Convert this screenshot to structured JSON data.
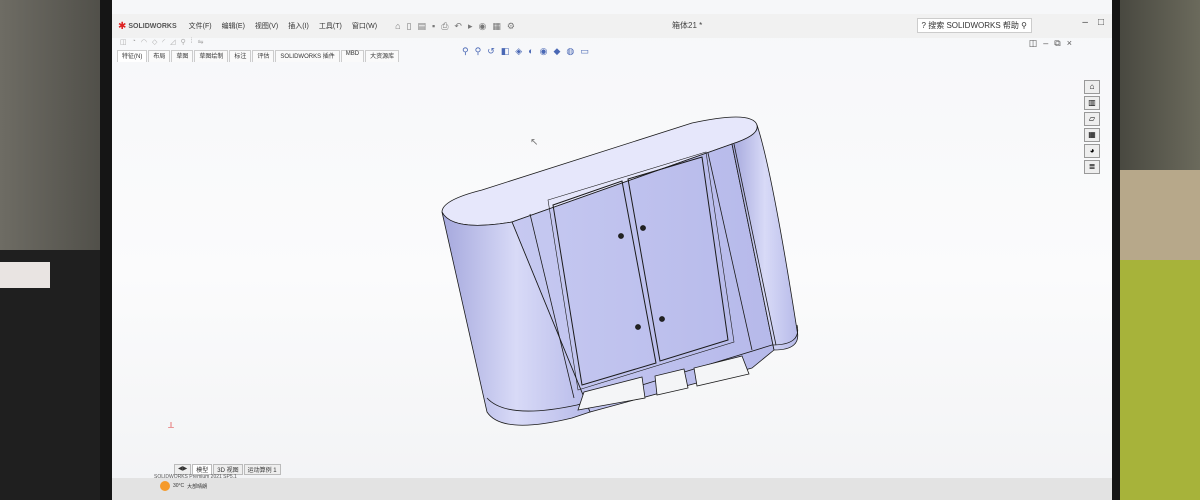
{
  "app": {
    "name": "SOLIDWORKS",
    "document_title": "箱体21 *"
  },
  "menu": [
    "文件(F)",
    "编辑(E)",
    "视图(V)",
    "插入(I)",
    "工具(T)",
    "窗口(W)"
  ],
  "search": {
    "label": "搜索 SOLIDWORKS 帮助"
  },
  "command_tabs": [
    "特征(N)",
    "布局",
    "草图",
    "草图绘制",
    "标注",
    "评估",
    "SOLIDWORKS 插件",
    "MBD",
    "大资源库"
  ],
  "bottom_tabs": [
    "模型",
    "3D 视图",
    "运动算例 1"
  ],
  "status_text": "SOLIDWORKS Premium 2021 SP5.1",
  "weather": {
    "temp": "30°C",
    "desc": "大部晴朗"
  },
  "colors": {
    "model_body": "#b9bcec",
    "model_outline": "#1a1a1a",
    "logo_red": "#d22222"
  },
  "icons": [
    "home-icon",
    "save-icon",
    "print-icon",
    "undo-icon",
    "select-arrow-icon",
    "rebuild-icon",
    "options-icon",
    "zoom-icon",
    "view-orientation-icon",
    "display-style-icon",
    "appearance-icon",
    "task-pane-icons"
  ]
}
